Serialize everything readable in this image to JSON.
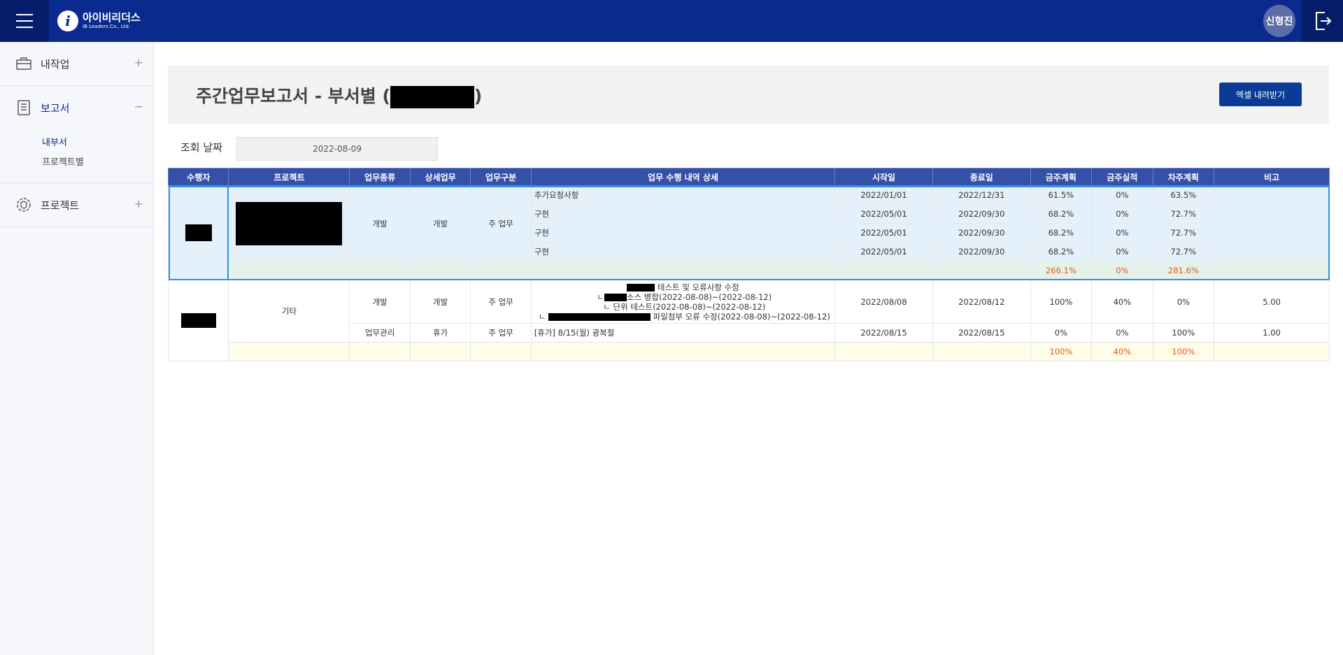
{
  "header": {
    "logo_text": "아이비리더스",
    "logo_sub": "IB Leaders Co., Ltd.",
    "user_name": "신형진",
    "colors": {
      "bar": "#0a2a8e",
      "dark": "#061d6b"
    }
  },
  "sidebar": {
    "groups": [
      {
        "label": "내작업",
        "icon": "briefcase-icon",
        "toggle": "+"
      },
      {
        "label": "보고서",
        "icon": "document-icon",
        "toggle": "−",
        "sub": [
          "내부서",
          "프로젝트별"
        ]
      },
      {
        "label": "프로젝트",
        "icon": "gear-shield-icon",
        "toggle": "+"
      }
    ]
  },
  "main": {
    "title": "주간업무보고서 - 부서별 (",
    "title_end": ")",
    "excel_button": "엑셀 내려받기",
    "date_label": "조회 날짜",
    "date_value": "2022-08-09"
  },
  "table": {
    "columns": [
      "수행자",
      "프로젝트",
      "업무종류",
      "상세업무",
      "업무구분",
      "업무 수행 내역 상세",
      "시작일",
      "종료일",
      "금주계획",
      "금주실적",
      "차주계획",
      "비고"
    ],
    "group1": {
      "work_type": "개발",
      "detail_work": "개발",
      "category": "주 업무",
      "rows": [
        {
          "detail": "추가요청사항",
          "start": "2022/01/01",
          "end": "2022/12/31",
          "plan": "61.5%",
          "actual": "0%",
          "next": "63.5%",
          "note": ""
        },
        {
          "detail": "구현",
          "start": "2022/05/01",
          "end": "2022/09/30",
          "plan": "68.2%",
          "actual": "0%",
          "next": "72.7%",
          "note": ""
        },
        {
          "detail": "구현",
          "start": "2022/05/01",
          "end": "2022/09/30",
          "plan": "68.2%",
          "actual": "0%",
          "next": "72.7%",
          "note": ""
        },
        {
          "detail": "구현",
          "start": "2022/05/01",
          "end": "2022/09/30",
          "plan": "68.2%",
          "actual": "0%",
          "next": "72.7%",
          "note": ""
        }
      ],
      "sum": {
        "plan": "266.1%",
        "actual": "0%",
        "next": "281.6%"
      }
    },
    "group2": {
      "project": "기타",
      "rows": [
        {
          "work_type": "개발",
          "detail_work": "개발",
          "category": "주 업무",
          "lines": [
            "테스트 및 오류사항 수정",
            "ㄴ",
            "소스 병합(2022-08-08)~(2022-08-12)",
            "ㄴ 단위 테스트(2022-08-08)~(2022-08-12)",
            "ㄴ",
            "파일첨부 오류 수정(2022-08-08)~(2022-08-12)"
          ],
          "start": "2022/08/08",
          "end": "2022/08/12",
          "plan": "100%",
          "actual": "40%",
          "next": "0%",
          "note": "5.00"
        },
        {
          "work_type": "업무관리",
          "detail_work": "휴가",
          "category": "주 업무",
          "detail": "[휴가] 8/15(월) 광복절",
          "start": "2022/08/15",
          "end": "2022/08/15",
          "plan": "0%",
          "actual": "0%",
          "next": "100%",
          "note": "1.00"
        }
      ],
      "sum": {
        "plan": "100%",
        "actual": "40%",
        "next": "100%"
      }
    }
  }
}
